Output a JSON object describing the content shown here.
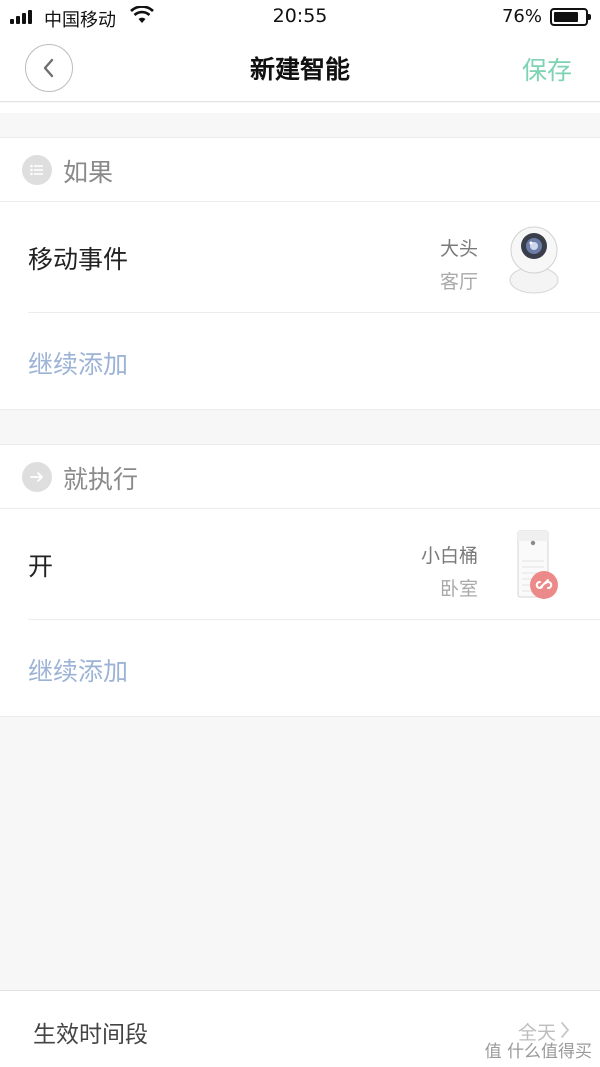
{
  "status_bar": {
    "carrier": "中国移动",
    "time": "20:55",
    "battery_percent": "76%",
    "battery_level": 0.76
  },
  "nav": {
    "title": "新建智能",
    "save_label": "保存"
  },
  "if_section": {
    "title": "如果",
    "icon": "list-icon",
    "rows": [
      {
        "title": "移动事件",
        "device_name": "大头",
        "device_room": "客厅",
        "device_icon": "camera-icon"
      }
    ],
    "add_more_label": "继续添加"
  },
  "then_section": {
    "title": "就执行",
    "icon": "arrow-right-icon",
    "rows": [
      {
        "title": "开",
        "device_name": "小白桶",
        "device_room": "卧室",
        "device_icon": "air-purifier-icon"
      }
    ],
    "add_more_label": "继续添加"
  },
  "effective_period": {
    "label": "生效时间段",
    "value": "全天"
  },
  "watermark": "值 什么值得买",
  "colors": {
    "accent_save": "#7dd3b3",
    "link_blue": "#9cb3d6",
    "background": "#f7f7f7",
    "badge_pink": "#ec8a8a"
  }
}
